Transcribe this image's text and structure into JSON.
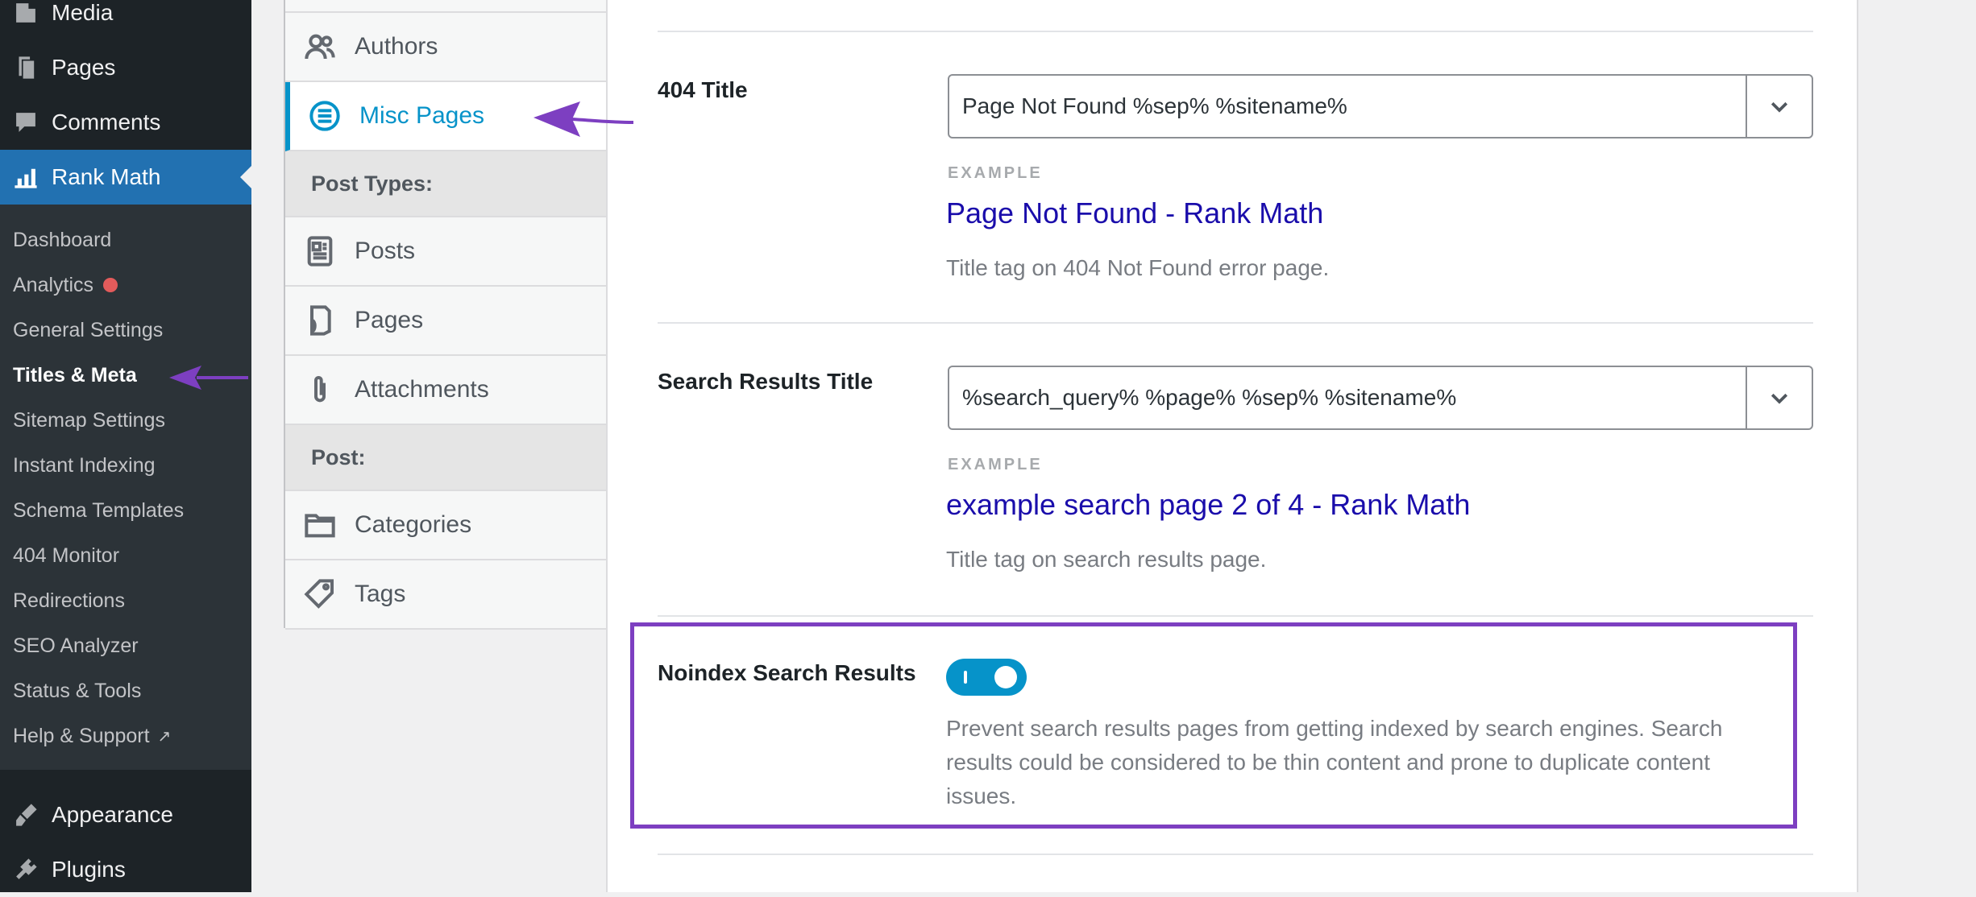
{
  "wp_menu": {
    "media": "Media",
    "pages": "Pages",
    "comments": "Comments",
    "rank_math": "Rank Math",
    "appearance": "Appearance",
    "plugins": "Plugins"
  },
  "rank_math_submenu": [
    {
      "label": "Dashboard"
    },
    {
      "label": "Analytics"
    },
    {
      "label": "General Settings"
    },
    {
      "label": "Titles & Meta"
    },
    {
      "label": "Sitemap Settings"
    },
    {
      "label": "Instant Indexing"
    },
    {
      "label": "Schema Templates"
    },
    {
      "label": "404 Monitor"
    },
    {
      "label": "Redirections"
    },
    {
      "label": "SEO Analyzer"
    },
    {
      "label": "Status & Tools"
    },
    {
      "label": "Help & Support"
    }
  ],
  "settings_nav": {
    "authors": "Authors",
    "misc_pages": "Misc Pages",
    "post_types_heading": "Post Types:",
    "posts": "Posts",
    "pages": "Pages",
    "attachments": "Attachments",
    "post_heading": "Post:",
    "categories": "Categories",
    "tags": "Tags"
  },
  "fields": {
    "title_404": {
      "label": "404 Title",
      "value": "Page Not Found %sep% %sitename%",
      "example_label": "EXAMPLE",
      "example_value": "Page Not Found - Rank Math",
      "description": "Title tag on 404 Not Found error page."
    },
    "search_title": {
      "label": "Search Results Title",
      "value": "%search_query% %page% %sep% %sitename%",
      "example_label": "EXAMPLE",
      "example_value": "example search page 2 of 4 - Rank Math",
      "description": "Title tag on search results page."
    },
    "noindex_search": {
      "label": "Noindex Search Results",
      "enabled": true,
      "description": "Prevent search results pages from getting indexed by search engines. Search results could be considered to be thin content and prone to duplicate content issues."
    }
  },
  "colors": {
    "wp_sidebar": "#1d2327",
    "wp_active": "#2271b1",
    "accent": "#0693c9",
    "example_link": "#1a0dab",
    "highlight_border": "#7d3fc1",
    "arrow": "#7d3fc1"
  },
  "icons": {
    "media": "media-icon",
    "pages": "pages-icon",
    "comments": "comments-icon",
    "rank_math": "rank-math-icon",
    "appearance": "paintbrush-icon",
    "plugins": "plug-icon",
    "authors": "users-icon",
    "misc_pages": "list-circle-icon",
    "posts": "document-icon",
    "pages_tab": "page-icon",
    "attachments": "paperclip-icon",
    "categories": "folder-icon",
    "tags": "tag-icon",
    "external": "external-link-icon",
    "dropdown": "chevron-down-icon"
  }
}
